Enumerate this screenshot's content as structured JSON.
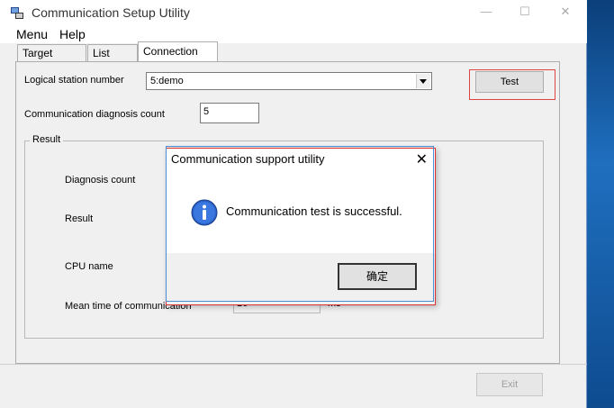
{
  "window": {
    "title": "Communication Setup Utility",
    "minimize_glyph": "—",
    "maximize_glyph": "☐",
    "close_glyph": "✕"
  },
  "menubar": {
    "items": [
      {
        "label": "Menu"
      },
      {
        "label": "Help"
      }
    ]
  },
  "tabs": [
    {
      "label": "Target setting",
      "active": false
    },
    {
      "label": "List view",
      "active": false
    },
    {
      "label": "Connection test",
      "active": true
    }
  ],
  "connection_test": {
    "logical_station_label": "Logical station number",
    "logical_station_value": "5:demo",
    "test_button": "Test",
    "diag_count_label": "Communication diagnosis count",
    "diag_count_value": "5",
    "result_group": {
      "title": "Result",
      "diagnosis_count_label": "Diagnosis count",
      "result_label": "Result",
      "cpu_name_label": "CPU name",
      "mean_time_label": "Mean time of communication",
      "mean_time_value": "16",
      "mean_time_unit": "ms"
    },
    "exit_button": "Exit"
  },
  "dialog": {
    "title": "Communication support utility",
    "close_glyph": "✕",
    "message": "Communication test is successful.",
    "ok_button": "确定",
    "icon": "info-icon"
  },
  "colors": {
    "desktop": "#1a5fa3",
    "info_icon": "#2a62c9",
    "focus_red": "#dd4444"
  }
}
